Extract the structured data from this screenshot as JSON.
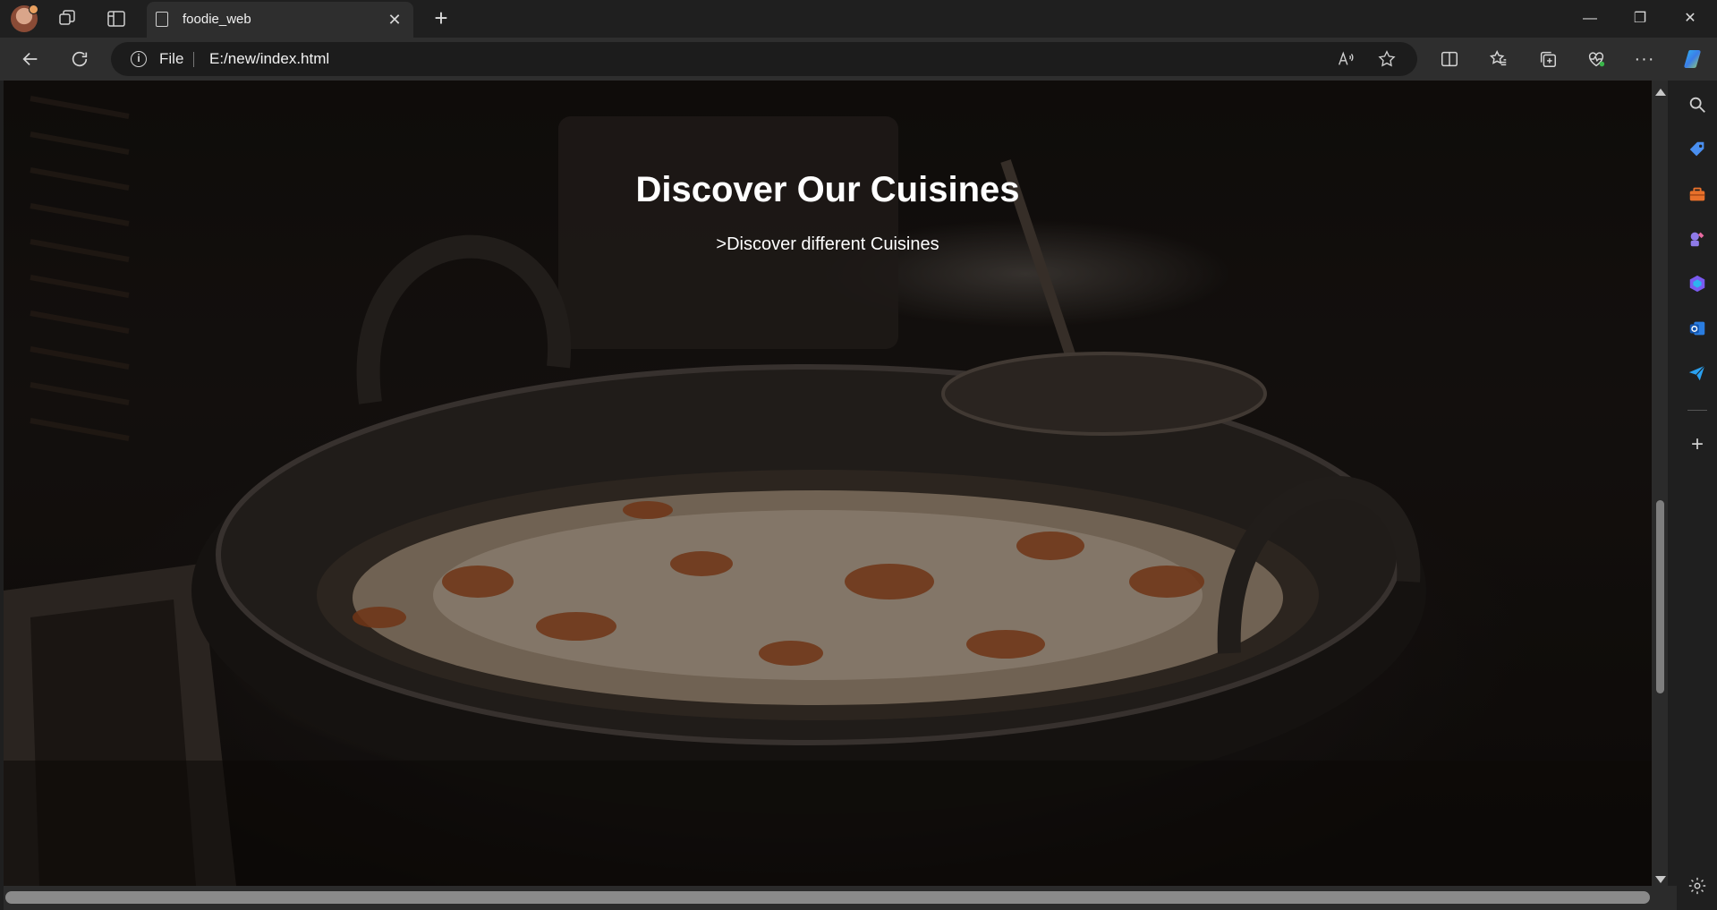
{
  "browser": {
    "tab": {
      "title": "foodie_web",
      "close_glyph": "✕"
    },
    "new_tab_glyph": "+",
    "window_controls": {
      "minimize": "—",
      "maximize": "❐",
      "close": "✕"
    },
    "address_bar": {
      "scheme_label": "File",
      "url": "E:/new/index.html"
    },
    "more_glyph": "···",
    "sidebar_add_glyph": "+"
  },
  "page": {
    "hero": {
      "title": "Discover Our Cuisines",
      "subtitle": ">Discover different Cuisines"
    }
  },
  "colors": {
    "browser_bg": "#1f1f1f",
    "toolbar_bg": "#2e2e2e",
    "hero_text": "#ffffff"
  }
}
